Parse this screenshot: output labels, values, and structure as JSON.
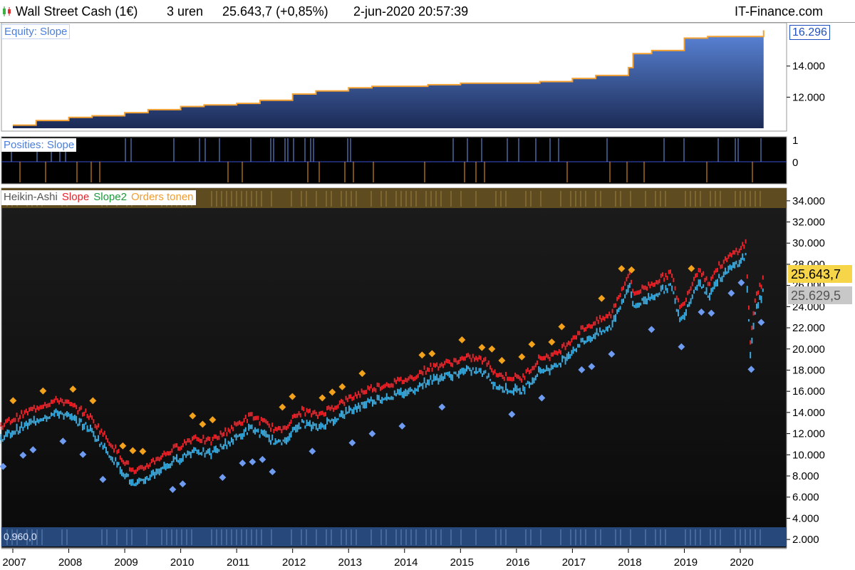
{
  "window": {
    "title": "Wall Street Cash (1€)",
    "timeframe": "3 uren",
    "last_price": "25.643,7 (+0,85%)",
    "datetime": "2-jun-2020 20:57:39",
    "brand": "IT-Finance.com"
  },
  "colors": {
    "equity_fill_top": "#5b86d9",
    "equity_fill_bottom": "#1b2a55",
    "equity_edge": "#f4a234",
    "long_position": "#6f9cf0",
    "short_position": "#f39c2a",
    "slope": "#e8232a",
    "slope2": "#1a9a3a",
    "orders": "#f3a21c",
    "candles": "#3aa9dd",
    "price_tag": "#f7d548",
    "last_tag": "#c8c8c8"
  },
  "panels": {
    "equity": {
      "label": "Equity: Slope",
      "last_value": "16.296"
    },
    "positions": {
      "label": "Posities: Slope",
      "ticks": [
        "1",
        "0"
      ]
    },
    "price": {
      "legend": [
        "Heikin-Ashi",
        "Slope",
        "Slope2",
        "Orders tonen"
      ],
      "price_tag": "25.643,7",
      "last_tag": "25.629,5",
      "volume_text": "0.960,0"
    }
  },
  "chart_data": [
    {
      "type": "area",
      "title": "Equity: Slope",
      "x": [
        "2007-01",
        "2007-06",
        "2008-01",
        "2008-06",
        "2009-01",
        "2009-06",
        "2010-01",
        "2010-06",
        "2011-01",
        "2011-06",
        "2012-01",
        "2012-06",
        "2013-01",
        "2013-06",
        "2014-01",
        "2014-06",
        "2015-01",
        "2015-06",
        "2016-01",
        "2016-06",
        "2017-01",
        "2017-06",
        "2018-01",
        "2018-02",
        "2018-06",
        "2019-01",
        "2019-06",
        "2020-01",
        "2020-05",
        "2020-06"
      ],
      "series": [
        {
          "name": "Equity: Slope",
          "values": [
            10.2,
            10.5,
            10.7,
            10.8,
            11.0,
            11.2,
            11.4,
            11.5,
            11.6,
            11.8,
            12.2,
            12.4,
            12.6,
            12.7,
            12.7,
            12.8,
            12.9,
            12.9,
            12.9,
            13.0,
            13.2,
            13.4,
            13.9,
            14.8,
            15.0,
            15.8,
            15.9,
            15.9,
            15.9,
            16.3
          ]
        }
      ],
      "ylim": [
        10.0,
        16.6
      ],
      "yticks": [
        "12.000",
        "14.000"
      ],
      "last_value": "16.296"
    },
    {
      "type": "bar",
      "title": "Posities: Slope",
      "yticks": [
        "1",
        "0"
      ],
      "note": "Thin vertical position markers: long (blue, above zero), short (orange, below zero)"
    },
    {
      "type": "line",
      "title": "Heikin-Ashi",
      "legend": [
        "Heikin-Ashi",
        "Slope",
        "Slope2",
        "Orders tonen"
      ],
      "x": [
        "2006-10",
        "2007-07",
        "2007-11",
        "2008-05",
        "2009-03",
        "2009-08",
        "2010-04",
        "2010-07",
        "2011-04",
        "2011-08",
        "2011-10",
        "2012-03",
        "2012-06",
        "2013-05",
        "2014-02",
        "2014-06",
        "2015-03",
        "2015-06",
        "2015-09",
        "2016-02",
        "2016-06",
        "2016-09",
        "2017-03",
        "2017-09",
        "2018-01",
        "2018-02",
        "2018-08",
        "2018-10",
        "2018-12",
        "2019-04",
        "2019-06",
        "2019-08",
        "2020-02",
        "2020-03",
        "2020-04",
        "2020-06"
      ],
      "series": [
        {
          "name": "Heikin-Ashi",
          "values": [
            11.5,
            13.5,
            14.0,
            12.6,
            7.0,
            8.5,
            10.5,
            10.0,
            12.5,
            11.5,
            11.0,
            13.0,
            12.5,
            15.0,
            16.0,
            17.0,
            18.0,
            17.7,
            16.3,
            16.0,
            18.0,
            18.2,
            20.7,
            22.0,
            26.0,
            24.0,
            25.5,
            26.0,
            22.5,
            26.5,
            25.0,
            26.5,
            28.8,
            19.5,
            23.5,
            25.6
          ]
        }
      ],
      "slope_offset": 1.2,
      "ylim": [
        1.2,
        35.2
      ],
      "yticks": [
        "34.000",
        "32.000",
        "30.000",
        "28.000",
        "26.000",
        "24.000",
        "22.000",
        "20.000",
        "18.000",
        "16.000",
        "14.000",
        "12.000",
        "10.000",
        "8.000",
        "6.000",
        "4.000",
        "2.000"
      ],
      "xticks": [
        "2007",
        "2008",
        "2009",
        "2010",
        "2011",
        "2012",
        "2013",
        "2014",
        "2015",
        "2016",
        "2017",
        "2018",
        "2019",
        "2020"
      ],
      "price_tag": "25.643,7",
      "last_tag": "25.629,5"
    }
  ]
}
